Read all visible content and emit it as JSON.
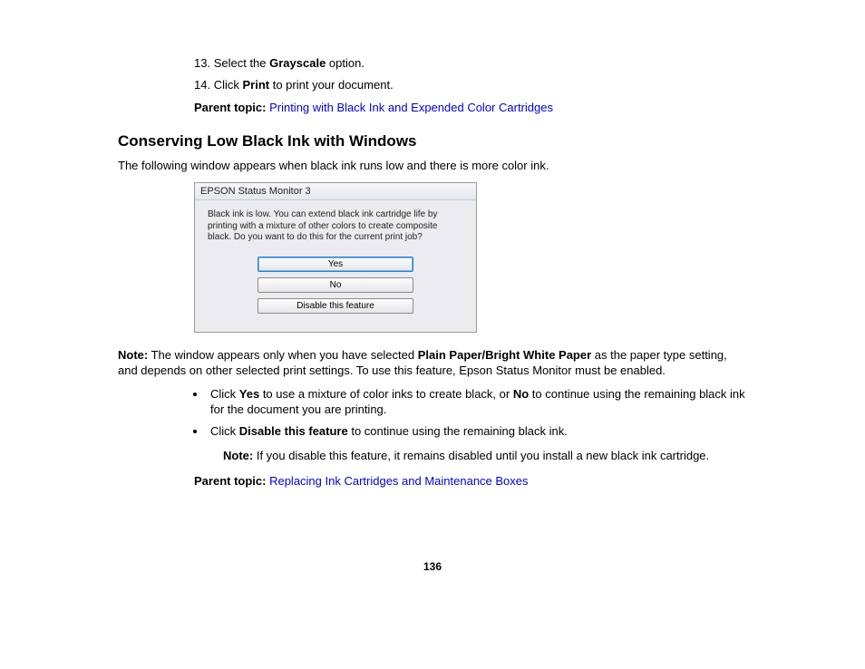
{
  "steps": {
    "s13_num": "13.",
    "s13_a": "Select the ",
    "s13_b": "Grayscale",
    "s13_c": " option.",
    "s14_num": "14.",
    "s14_a": "Click ",
    "s14_b": "Print",
    "s14_c": " to print your document."
  },
  "parent1": {
    "label": "Parent topic: ",
    "link": "Printing with Black Ink and Expended Color Cartridges"
  },
  "heading": "Conserving Low Black Ink with Windows",
  "intro": "The following window appears when black ink runs low and there is more color ink.",
  "dialog": {
    "title": "EPSON Status Monitor 3",
    "msg": "Black ink is low. You can extend black ink cartridge life by printing with a mixture of other colors to create composite black.\nDo you want to do this for the current print job?",
    "btn_yes": "Yes",
    "btn_no": "No",
    "btn_disable": "Disable this feature"
  },
  "note1": {
    "prefix": "Note:",
    "a": " The window appears only when you have selected ",
    "b": "Plain Paper/Bright White Paper",
    "c": " as the paper type setting, and depends on other selected print settings. To use this feature, Epson Status Monitor must be enabled."
  },
  "bullets": {
    "b1_a": "Click ",
    "b1_yes": "Yes",
    "b1_b": " to use a mixture of color inks to create black, or ",
    "b1_no": "No",
    "b1_c": " to continue using the remaining black ink for the document you are printing.",
    "b2_a": "Click ",
    "b2_b": "Disable this feature",
    "b2_c": " to continue using the remaining black ink."
  },
  "note2": {
    "prefix": "Note:",
    "text": " If you disable this feature, it remains disabled until you install a new black ink cartridge."
  },
  "parent2": {
    "label": "Parent topic: ",
    "link": "Replacing Ink Cartridges and Maintenance Boxes"
  },
  "page_number": "136"
}
